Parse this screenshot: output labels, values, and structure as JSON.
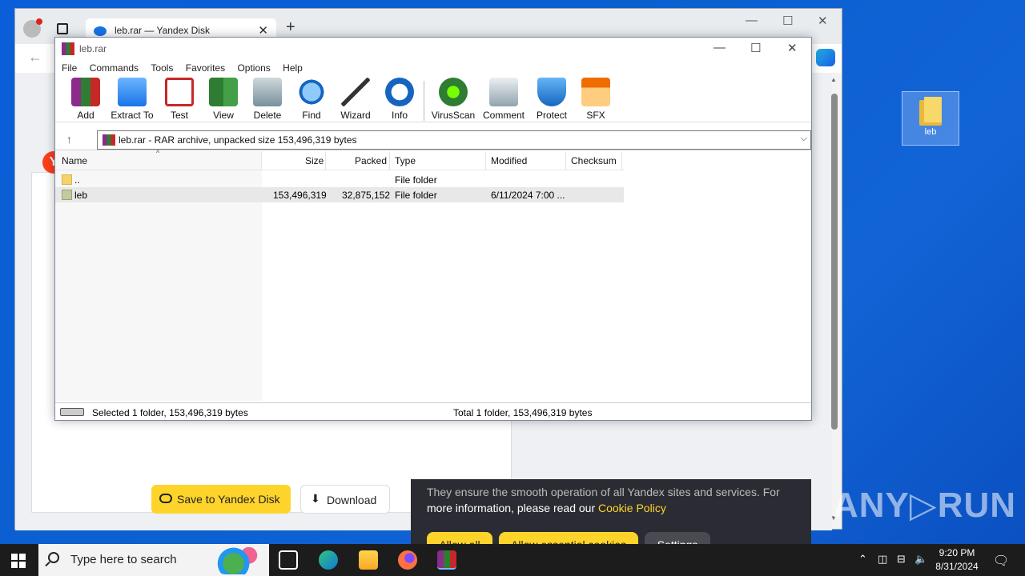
{
  "desktop": {
    "icon_label": "leb"
  },
  "browser": {
    "tab_title": "leb.rar — Yandex Disk",
    "page": {
      "save_button": "Save to Yandex Disk",
      "download_button": "Download",
      "cookie": {
        "line1": "They ensure the smooth operation of all Yandex sites and services. For",
        "line2_prefix": "more information, please read our ",
        "link": "Cookie Policy",
        "allow_all": "Allow all",
        "allow_essential": "Allow essential cookies",
        "settings": "Settings"
      }
    }
  },
  "winrar": {
    "title": "leb.rar",
    "menu": [
      "File",
      "Commands",
      "Tools",
      "Favorites",
      "Options",
      "Help"
    ],
    "toolbar": [
      {
        "label": "Add",
        "icon": "add-archive-icon"
      },
      {
        "label": "Extract To",
        "icon": "extract-folder-icon"
      },
      {
        "label": "Test",
        "icon": "test-clipboard-icon"
      },
      {
        "label": "View",
        "icon": "view-book-icon"
      },
      {
        "label": "Delete",
        "icon": "trash-icon"
      },
      {
        "label": "Find",
        "icon": "magnifier-icon"
      },
      {
        "label": "Wizard",
        "icon": "magic-wand-icon"
      },
      {
        "label": "Info",
        "icon": "info-icon"
      },
      {
        "label": "VirusScan",
        "icon": "virus-scan-icon"
      },
      {
        "label": "Comment",
        "icon": "comment-icon"
      },
      {
        "label": "Protect",
        "icon": "shield-icon"
      },
      {
        "label": "SFX",
        "icon": "sfx-box-icon"
      }
    ],
    "path": "leb.rar - RAR archive, unpacked size 153,496,319 bytes",
    "columns": [
      "Name",
      "Size",
      "Packed",
      "Type",
      "Modified",
      "Checksum"
    ],
    "rows": [
      {
        "name": "..",
        "size": "",
        "packed": "",
        "type": "File folder",
        "modified": "",
        "checksum": ""
      },
      {
        "name": "leb",
        "size": "153,496,319",
        "packed": "32,875,152",
        "type": "File folder",
        "modified": "6/11/2024 7:00 ...",
        "checksum": ""
      }
    ],
    "status_left": "Selected 1 folder, 153,496,319 bytes",
    "status_right": "Total 1 folder, 153,496,319 bytes"
  },
  "watermark": "ANY▷RUN",
  "taskbar": {
    "search_placeholder": "Type here to search",
    "time": "9:20 PM",
    "date": "8/31/2024"
  },
  "colors": {
    "desktop_bg": "#0b5fcf",
    "yandex_yellow": "#fed42b",
    "cookie_bg": "#2b2c33",
    "taskbar_bg": "#1c1c1c"
  }
}
